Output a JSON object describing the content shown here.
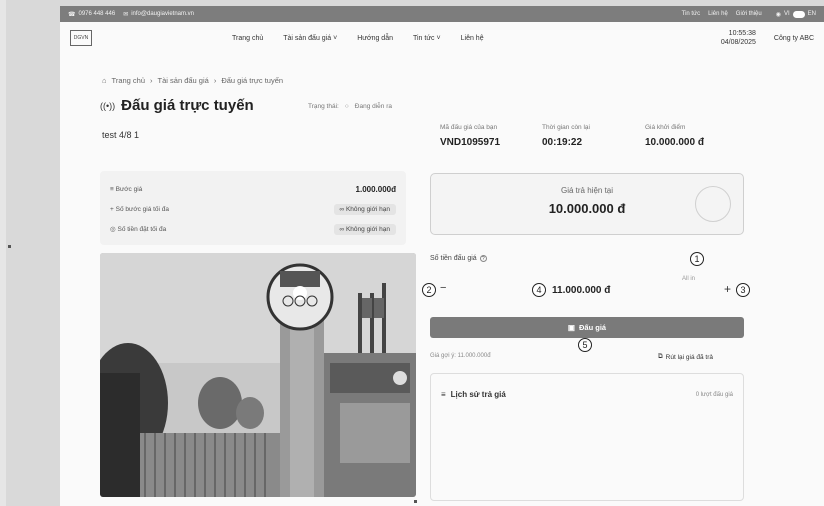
{
  "topbar": {
    "phone": "0976 448 446",
    "email": "info@daugiavietnam.vn",
    "links": [
      "Tin tức",
      "Liên hệ",
      "Giới thiệu"
    ],
    "lang_vi": "VI",
    "lang_en": "EN"
  },
  "header": {
    "nav": [
      "Trang chủ",
      "Tài sản đấu giá",
      "Hướng dẫn",
      "Tin tức",
      "Liên hệ"
    ],
    "time": "10:55:38",
    "date": "04/08/2025",
    "user": "Công ty ABC"
  },
  "breadcrumb": [
    "Trang chủ",
    "Tài sản đấu giá",
    "Đấu giá trực tuyến"
  ],
  "title": "Đấu giá trực tuyến",
  "status_label": "Trạng thái:",
  "status_value": "Đang diễn ra",
  "lot_name": "test 4/8 1",
  "info": {
    "step_label": "Bước giá",
    "step_value": "1.000.000đ",
    "max_steps_label": "Số bước giá tối đa",
    "max_steps_value": "Không giới hạn",
    "max_amount_label": "Số tiền đặt tối đa",
    "max_amount_value": "Không giới hạn"
  },
  "meta": {
    "code_label": "Mã đấu giá của bạn",
    "code_value": "VND1095971",
    "time_label": "Thời gian còn lại",
    "time_value": "00:19:22",
    "start_label": "Giá khởi điểm",
    "start_value": "10.000.000 đ"
  },
  "current_price": {
    "label": "Giá trả hiện tại",
    "value": "10.000.000 đ"
  },
  "bid": {
    "label": "Số tiền đấu giá",
    "minus": "−",
    "plus": "+",
    "amount": "11.000.000 đ",
    "all_in": "All in",
    "button": "Đấu giá",
    "footer_left": "Giá gợi ý: 11.000.000đ",
    "footer_right": "Rút lại giá đã trả"
  },
  "history": {
    "title": "Lịch sử trả giá",
    "count": "0 lượt đấu giá"
  },
  "annotations": [
    "1",
    "2",
    "3",
    "4",
    "5"
  ],
  "colors": {
    "topbar": "#7d7d7d",
    "bid_button": "#7a7a7a"
  }
}
